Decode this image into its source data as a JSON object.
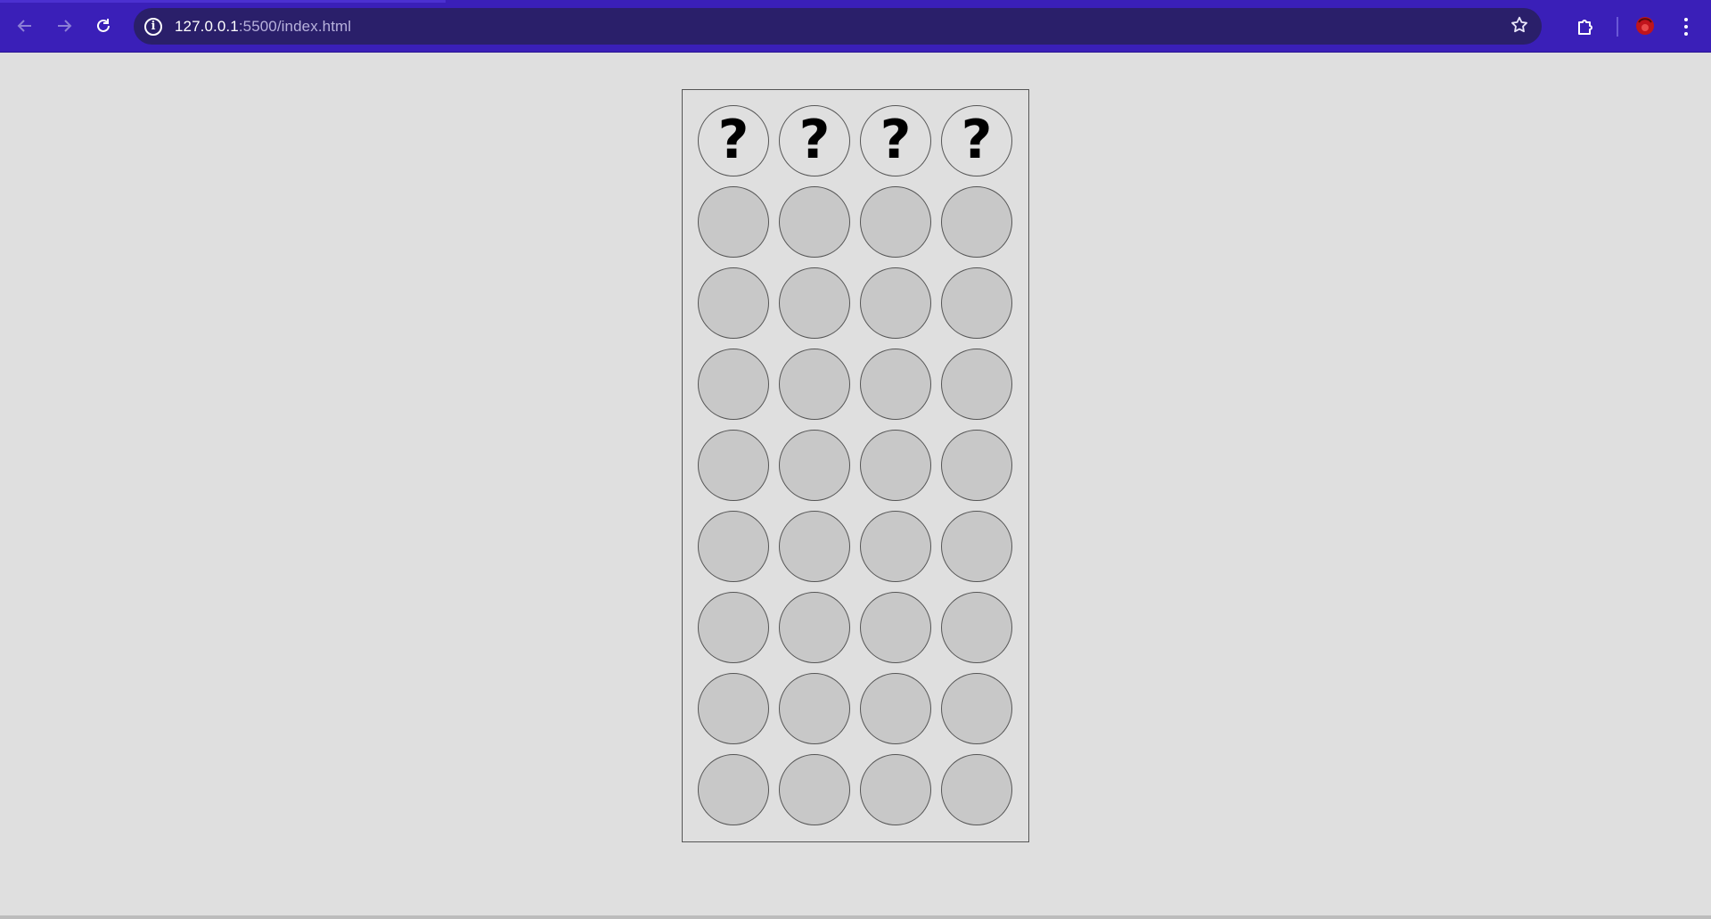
{
  "browser": {
    "url_host": "127.0.0.1",
    "url_rest": ":5500/index.html",
    "icons": {
      "back": "arrow-left-icon",
      "forward": "arrow-right-icon",
      "reload": "reload-icon",
      "info": "info-icon",
      "bookmark": "star-icon",
      "extensions": "puzzle-icon",
      "profile": "profile-icon",
      "menu": "kebab-menu-icon"
    },
    "colors": {
      "toolbar": "#3a1fb8",
      "address_bar": "#2a1f6a"
    }
  },
  "game": {
    "secret_symbol": "?",
    "secret_slots": 4,
    "guess_rows": 8,
    "pegs_per_row": 4,
    "colors": {
      "background": "#dfdfdf",
      "empty_peg": "#c8c8c8",
      "border": "#555555"
    }
  }
}
